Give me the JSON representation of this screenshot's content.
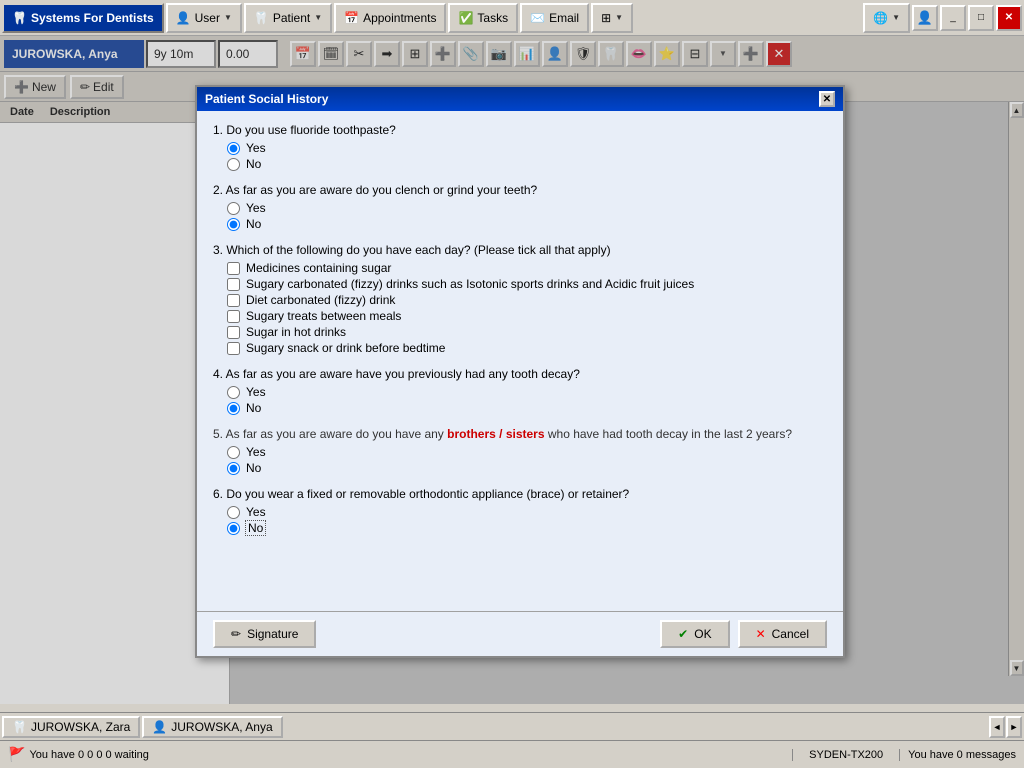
{
  "app": {
    "title": "Systems For Dentists",
    "menu_items": [
      {
        "label": "User",
        "icon": "👤"
      },
      {
        "label": "Patient",
        "icon": "🦷"
      },
      {
        "label": "Appointments",
        "icon": "📅"
      },
      {
        "label": "Tasks",
        "icon": "✅"
      },
      {
        "label": "Email",
        "icon": "✉️"
      }
    ]
  },
  "patient": {
    "name": "JUROWSKA, Anya",
    "age": "9y 10m",
    "balance": "0.00"
  },
  "action_bar": {
    "new_label": "New",
    "edit_label": "Edit"
  },
  "left_panel": {
    "col1": "Date",
    "col2": "Description"
  },
  "dialog": {
    "title": "Patient Social History",
    "questions": [
      {
        "id": "q1",
        "text": "1. Do you use fluoride toothpaste?",
        "type": "radio",
        "options": [
          "Yes",
          "No"
        ],
        "selected": "Yes"
      },
      {
        "id": "q2",
        "text": "2. As far as you are aware do you clench or grind your teeth?",
        "type": "radio",
        "options": [
          "Yes",
          "No"
        ],
        "selected": "No"
      },
      {
        "id": "q3",
        "text": "3. Which of the following do you have each day? (Please tick all that apply)",
        "type": "checkbox",
        "options": [
          "Medicines containing sugar",
          "Sugary carbonated (fizzy) drinks such as Isotonic sports drinks and Acidic fruit juices",
          "Diet carbonated (fizzy) drink",
          "Sugary treats between meals",
          "Sugar in hot drinks",
          "Sugary snack or drink before bedtime"
        ],
        "checked": []
      },
      {
        "id": "q4",
        "text": "4. As far as you are aware have you previously had any tooth decay?",
        "type": "radio",
        "options": [
          "Yes",
          "No"
        ],
        "selected": "No"
      },
      {
        "id": "q5",
        "text": "5. As far as you are aware do you have any brothers / sisters who have had tooth decay in the last 2 years?",
        "type": "radio",
        "options": [
          "Yes",
          "No"
        ],
        "selected": "No",
        "highlight": true
      },
      {
        "id": "q6",
        "text": "6. Do you wear a fixed or removable orthodontic appliance (brace) or retainer?",
        "type": "radio",
        "options": [
          "Yes",
          "No"
        ],
        "selected": "No"
      }
    ],
    "buttons": {
      "signature": "Signature",
      "ok": "OK",
      "cancel": "Cancel"
    }
  },
  "taskbar": {
    "items": [
      {
        "label": "JUROWSKA, Zara",
        "icon": "🦷"
      },
      {
        "label": "JUROWSKA, Anya",
        "icon": "👤"
      }
    ]
  },
  "status": {
    "message": "You have 0 0 0 0 waiting",
    "system": "SYDEN-TX200",
    "messages": "You have 0 messages"
  }
}
